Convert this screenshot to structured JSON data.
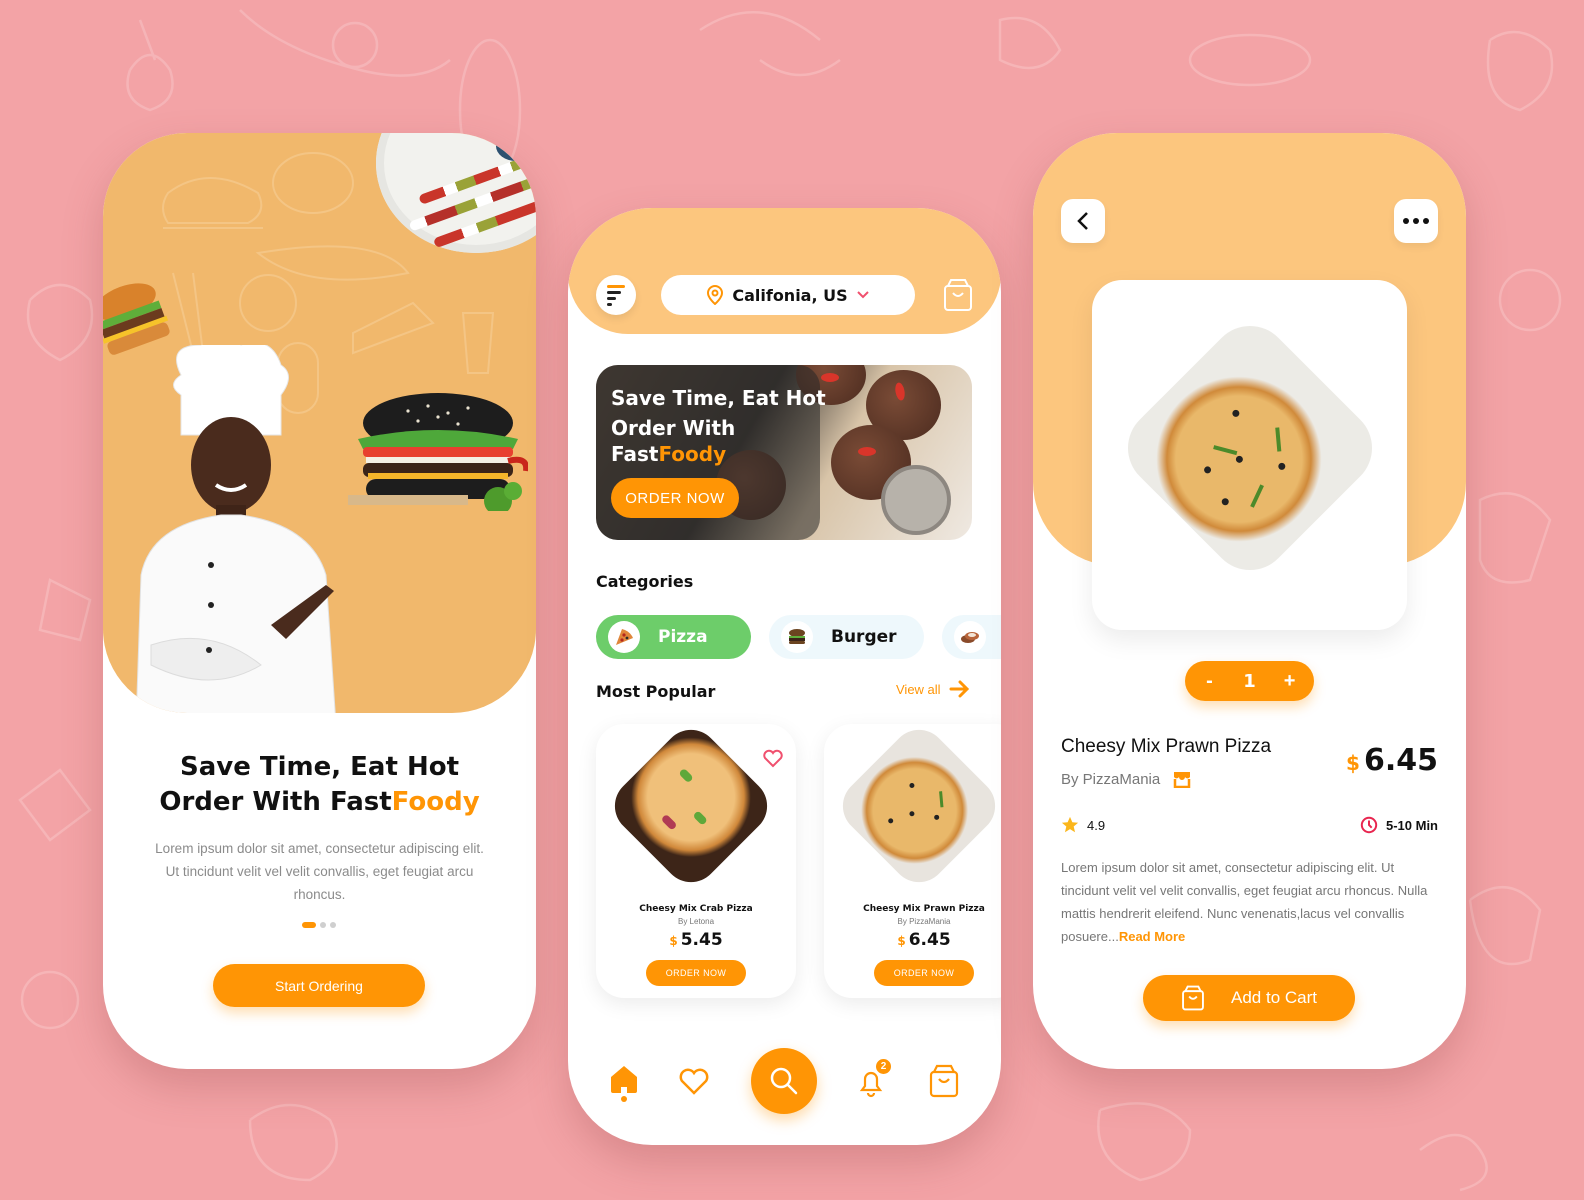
{
  "colors": {
    "background": "#f3a3a6",
    "accent": "#ff9505",
    "hero": "#f1b86c",
    "header": "#fcc67e",
    "category_active": "#6dcd6a",
    "category_inactive": "#eef8fc"
  },
  "onboarding": {
    "headline_line1": "Save Time, Eat Hot",
    "headline_line2_prefix": "Order With Fast",
    "headline_line2_accent": "Foody",
    "description": "Lorem ipsum dolor sit amet, consectetur adipiscing elit. Ut tincidunt velit vel velit convallis, eget feugiat arcu rhoncus.",
    "pagination": {
      "total": 3,
      "active": 1
    },
    "cta_label": "Start Ordering"
  },
  "home": {
    "menu_icon": "menu-icon",
    "location": "Califonia, US",
    "cart_icon": "shopping-bag-icon",
    "banner": {
      "line1": "Save Time, Eat Hot",
      "line2": "Order With",
      "line3_prefix": "Fast",
      "line3_accent": "Foody",
      "button": "ORDER NOW"
    },
    "categories_title": "Categories",
    "categories": [
      {
        "label": "Pizza",
        "icon": "pizza-icon",
        "active": true
      },
      {
        "label": "Burger",
        "icon": "burger-icon",
        "active": false
      },
      {
        "label": "",
        "icon": "sushi-icon",
        "active": false
      }
    ],
    "popular_title": "Most Popular",
    "view_all": "View all",
    "products": [
      {
        "name": "Cheesy Mix Crab Pizza",
        "by": "By Letona",
        "currency": "$",
        "price": "5.45",
        "button": "ORDER NOW"
      },
      {
        "name": "Cheesy Mix Prawn Pizza",
        "by": "By PizzaMania",
        "currency": "$",
        "price": "6.45",
        "button": "ORDER NOW"
      }
    ],
    "nav": {
      "items": [
        "home",
        "favorites",
        "search",
        "notifications",
        "cart"
      ],
      "active": "home",
      "notification_count": "2"
    }
  },
  "detail": {
    "back_icon": "chevron-left-icon",
    "more_icon": "more-horizontal-icon",
    "quantity": "1",
    "minus": "-",
    "plus": "+",
    "name": "Cheesy Mix Prawn Pizza",
    "by": "By PizzaMania",
    "currency": "$",
    "price": "6.45",
    "rating": "4.9",
    "delivery_time": "5-10 Min",
    "description": "Lorem ipsum dolor sit amet, consectetur adipiscing elit. Ut tincidunt velit vel velit convallis, eget feugiat arcu rhoncus. Nulla mattis hendrerit eleifend. Nunc venenatis,lacus vel convallis posuere...",
    "read_more": "Read More",
    "add_to_cart": "Add to Cart"
  }
}
